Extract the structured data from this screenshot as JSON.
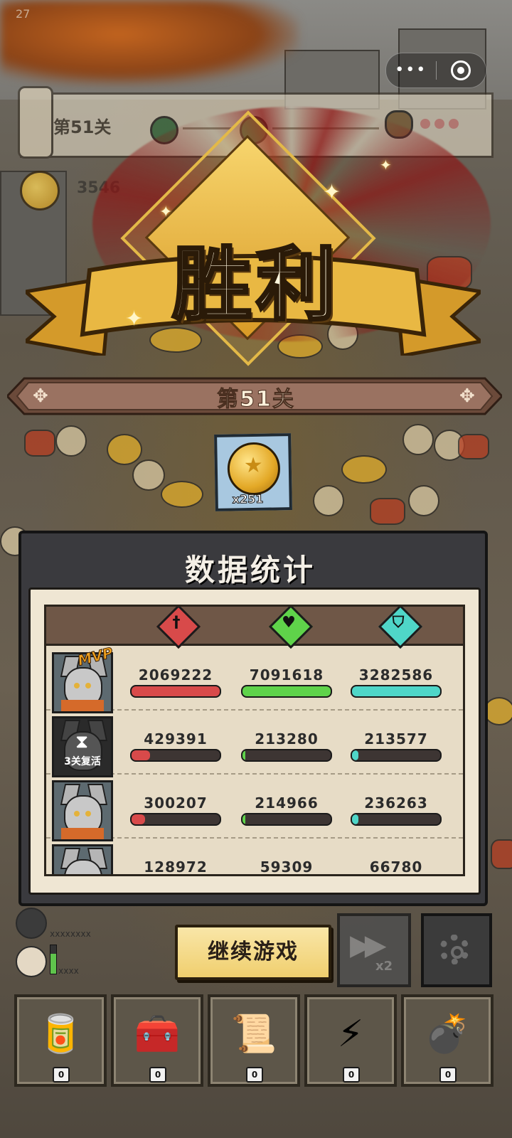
{
  "status": {
    "fps": "27"
  },
  "level_bar": {
    "label": "第51关"
  },
  "top_coins": {
    "value": "3546"
  },
  "victory": {
    "title": "胜利"
  },
  "stage": {
    "label": "第51关"
  },
  "reward": {
    "icon": "gold-coin-icon",
    "count": "x251"
  },
  "stats": {
    "title": "数据统计",
    "columns": [
      {
        "icon": "damage-icon",
        "color": "#d84a4a"
      },
      {
        "icon": "heal-icon",
        "color": "#5fd34a"
      },
      {
        "icon": "shield-icon",
        "color": "#4fd6c8"
      }
    ],
    "rows": [
      {
        "badge": "MVP",
        "revive_text": "",
        "damage": "2069222",
        "heal": "7091618",
        "shield": "3282586",
        "damage_pct": 100,
        "heal_pct": 100,
        "shield_pct": 100
      },
      {
        "badge": "",
        "revive_text": "3关复活",
        "damage": "429391",
        "heal": "213280",
        "shield": "213577",
        "damage_pct": 21,
        "heal_pct": 3,
        "shield_pct": 7
      },
      {
        "badge": "",
        "revive_text": "",
        "damage": "300207",
        "heal": "214966",
        "shield": "236263",
        "damage_pct": 15,
        "heal_pct": 3,
        "shield_pct": 7
      },
      {
        "badge": "",
        "revive_text": "",
        "damage": "128972",
        "heal": "59309",
        "shield": "66780",
        "damage_pct": 6,
        "heal_pct": 1,
        "shield_pct": 2
      }
    ]
  },
  "allies": [
    {
      "name": "xxxxxxxx"
    },
    {
      "name": "xxxx"
    }
  ],
  "buttons": {
    "continue": "继续游戏",
    "speed": "x2"
  },
  "items": [
    {
      "icon": "cola-can-icon",
      "glyph": "🥫",
      "qty": "0"
    },
    {
      "icon": "first-aid-kit-icon",
      "glyph": "🧰",
      "qty": "0"
    },
    {
      "icon": "scroll-map-icon",
      "glyph": "📜",
      "qty": "0"
    },
    {
      "icon": "lightning-paper-icon",
      "glyph": "⚡",
      "qty": "0"
    },
    {
      "icon": "bomb-icon",
      "glyph": "💣",
      "qty": "0"
    }
  ]
}
